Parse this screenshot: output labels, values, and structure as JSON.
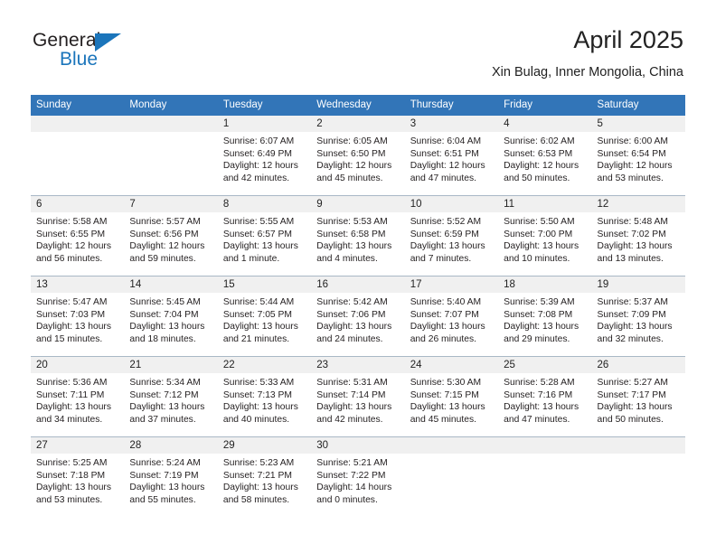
{
  "brand": {
    "name_top": "General",
    "name_bottom": "Blue",
    "accent_color": "#1b75bb"
  },
  "header": {
    "title": "April 2025",
    "subtitle": "Xin Bulag, Inner Mongolia, China"
  },
  "calendar": {
    "header_bg": "#3275b8",
    "daynum_bg": "#f0f0f0",
    "weekdays": [
      "Sunday",
      "Monday",
      "Tuesday",
      "Wednesday",
      "Thursday",
      "Friday",
      "Saturday"
    ],
    "labels": {
      "sunrise": "Sunrise:",
      "sunset": "Sunset:",
      "daylight": "Daylight:"
    },
    "weeks": [
      [
        {
          "day": "",
          "empty": true
        },
        {
          "day": "",
          "empty": true
        },
        {
          "day": "1",
          "sunrise": "Sunrise: 6:07 AM",
          "sunset": "Sunset: 6:49 PM",
          "daylight": "Daylight: 12 hours and 42 minutes."
        },
        {
          "day": "2",
          "sunrise": "Sunrise: 6:05 AM",
          "sunset": "Sunset: 6:50 PM",
          "daylight": "Daylight: 12 hours and 45 minutes."
        },
        {
          "day": "3",
          "sunrise": "Sunrise: 6:04 AM",
          "sunset": "Sunset: 6:51 PM",
          "daylight": "Daylight: 12 hours and 47 minutes."
        },
        {
          "day": "4",
          "sunrise": "Sunrise: 6:02 AM",
          "sunset": "Sunset: 6:53 PM",
          "daylight": "Daylight: 12 hours and 50 minutes."
        },
        {
          "day": "5",
          "sunrise": "Sunrise: 6:00 AM",
          "sunset": "Sunset: 6:54 PM",
          "daylight": "Daylight: 12 hours and 53 minutes."
        }
      ],
      [
        {
          "day": "6",
          "sunrise": "Sunrise: 5:58 AM",
          "sunset": "Sunset: 6:55 PM",
          "daylight": "Daylight: 12 hours and 56 minutes."
        },
        {
          "day": "7",
          "sunrise": "Sunrise: 5:57 AM",
          "sunset": "Sunset: 6:56 PM",
          "daylight": "Daylight: 12 hours and 59 minutes."
        },
        {
          "day": "8",
          "sunrise": "Sunrise: 5:55 AM",
          "sunset": "Sunset: 6:57 PM",
          "daylight": "Daylight: 13 hours and 1 minute."
        },
        {
          "day": "9",
          "sunrise": "Sunrise: 5:53 AM",
          "sunset": "Sunset: 6:58 PM",
          "daylight": "Daylight: 13 hours and 4 minutes."
        },
        {
          "day": "10",
          "sunrise": "Sunrise: 5:52 AM",
          "sunset": "Sunset: 6:59 PM",
          "daylight": "Daylight: 13 hours and 7 minutes."
        },
        {
          "day": "11",
          "sunrise": "Sunrise: 5:50 AM",
          "sunset": "Sunset: 7:00 PM",
          "daylight": "Daylight: 13 hours and 10 minutes."
        },
        {
          "day": "12",
          "sunrise": "Sunrise: 5:48 AM",
          "sunset": "Sunset: 7:02 PM",
          "daylight": "Daylight: 13 hours and 13 minutes."
        }
      ],
      [
        {
          "day": "13",
          "sunrise": "Sunrise: 5:47 AM",
          "sunset": "Sunset: 7:03 PM",
          "daylight": "Daylight: 13 hours and 15 minutes."
        },
        {
          "day": "14",
          "sunrise": "Sunrise: 5:45 AM",
          "sunset": "Sunset: 7:04 PM",
          "daylight": "Daylight: 13 hours and 18 minutes."
        },
        {
          "day": "15",
          "sunrise": "Sunrise: 5:44 AM",
          "sunset": "Sunset: 7:05 PM",
          "daylight": "Daylight: 13 hours and 21 minutes."
        },
        {
          "day": "16",
          "sunrise": "Sunrise: 5:42 AM",
          "sunset": "Sunset: 7:06 PM",
          "daylight": "Daylight: 13 hours and 24 minutes."
        },
        {
          "day": "17",
          "sunrise": "Sunrise: 5:40 AM",
          "sunset": "Sunset: 7:07 PM",
          "daylight": "Daylight: 13 hours and 26 minutes."
        },
        {
          "day": "18",
          "sunrise": "Sunrise: 5:39 AM",
          "sunset": "Sunset: 7:08 PM",
          "daylight": "Daylight: 13 hours and 29 minutes."
        },
        {
          "day": "19",
          "sunrise": "Sunrise: 5:37 AM",
          "sunset": "Sunset: 7:09 PM",
          "daylight": "Daylight: 13 hours and 32 minutes."
        }
      ],
      [
        {
          "day": "20",
          "sunrise": "Sunrise: 5:36 AM",
          "sunset": "Sunset: 7:11 PM",
          "daylight": "Daylight: 13 hours and 34 minutes."
        },
        {
          "day": "21",
          "sunrise": "Sunrise: 5:34 AM",
          "sunset": "Sunset: 7:12 PM",
          "daylight": "Daylight: 13 hours and 37 minutes."
        },
        {
          "day": "22",
          "sunrise": "Sunrise: 5:33 AM",
          "sunset": "Sunset: 7:13 PM",
          "daylight": "Daylight: 13 hours and 40 minutes."
        },
        {
          "day": "23",
          "sunrise": "Sunrise: 5:31 AM",
          "sunset": "Sunset: 7:14 PM",
          "daylight": "Daylight: 13 hours and 42 minutes."
        },
        {
          "day": "24",
          "sunrise": "Sunrise: 5:30 AM",
          "sunset": "Sunset: 7:15 PM",
          "daylight": "Daylight: 13 hours and 45 minutes."
        },
        {
          "day": "25",
          "sunrise": "Sunrise: 5:28 AM",
          "sunset": "Sunset: 7:16 PM",
          "daylight": "Daylight: 13 hours and 47 minutes."
        },
        {
          "day": "26",
          "sunrise": "Sunrise: 5:27 AM",
          "sunset": "Sunset: 7:17 PM",
          "daylight": "Daylight: 13 hours and 50 minutes."
        }
      ],
      [
        {
          "day": "27",
          "sunrise": "Sunrise: 5:25 AM",
          "sunset": "Sunset: 7:18 PM",
          "daylight": "Daylight: 13 hours and 53 minutes."
        },
        {
          "day": "28",
          "sunrise": "Sunrise: 5:24 AM",
          "sunset": "Sunset: 7:19 PM",
          "daylight": "Daylight: 13 hours and 55 minutes."
        },
        {
          "day": "29",
          "sunrise": "Sunrise: 5:23 AM",
          "sunset": "Sunset: 7:21 PM",
          "daylight": "Daylight: 13 hours and 58 minutes."
        },
        {
          "day": "30",
          "sunrise": "Sunrise: 5:21 AM",
          "sunset": "Sunset: 7:22 PM",
          "daylight": "Daylight: 14 hours and 0 minutes."
        },
        {
          "day": "",
          "empty": true
        },
        {
          "day": "",
          "empty": true
        },
        {
          "day": "",
          "empty": true
        }
      ]
    ]
  }
}
